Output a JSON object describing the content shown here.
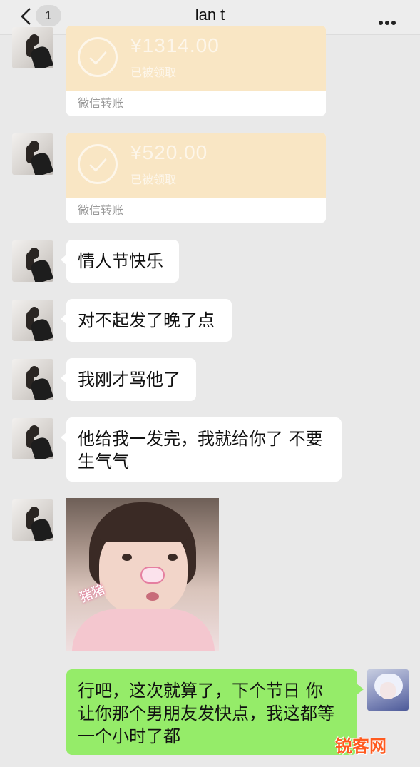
{
  "header": {
    "back_icon": "chevron-left-icon",
    "unread_count": "1",
    "title": "lan t",
    "more_icon": "more-dots-icon"
  },
  "transfers": [
    {
      "amount": "¥1314.00",
      "status": "已被领取",
      "label": "微信转账"
    },
    {
      "amount": "¥520.00",
      "status": "已被领取",
      "label": "微信转账"
    }
  ],
  "messages": {
    "m1": "情人节快乐",
    "m2": "对不起发了晚了点",
    "m3": "我刚才骂他了",
    "m4_line1": "他给我一发完，我就给你了 不要",
    "m4_line2": "生气气",
    "sticker_text": "猪猪",
    "my_line1": "行吧，这次就算了，下个节日 你",
    "my_line2": "让你那个男朋友发快点，我这都等",
    "my_line3": "一个小时了都"
  },
  "colors": {
    "incoming": "#ffffff",
    "outgoing": "#95ec69",
    "transfer": "#f9e6c4",
    "background": "#e9e9e9"
  },
  "watermark": "锐客网"
}
